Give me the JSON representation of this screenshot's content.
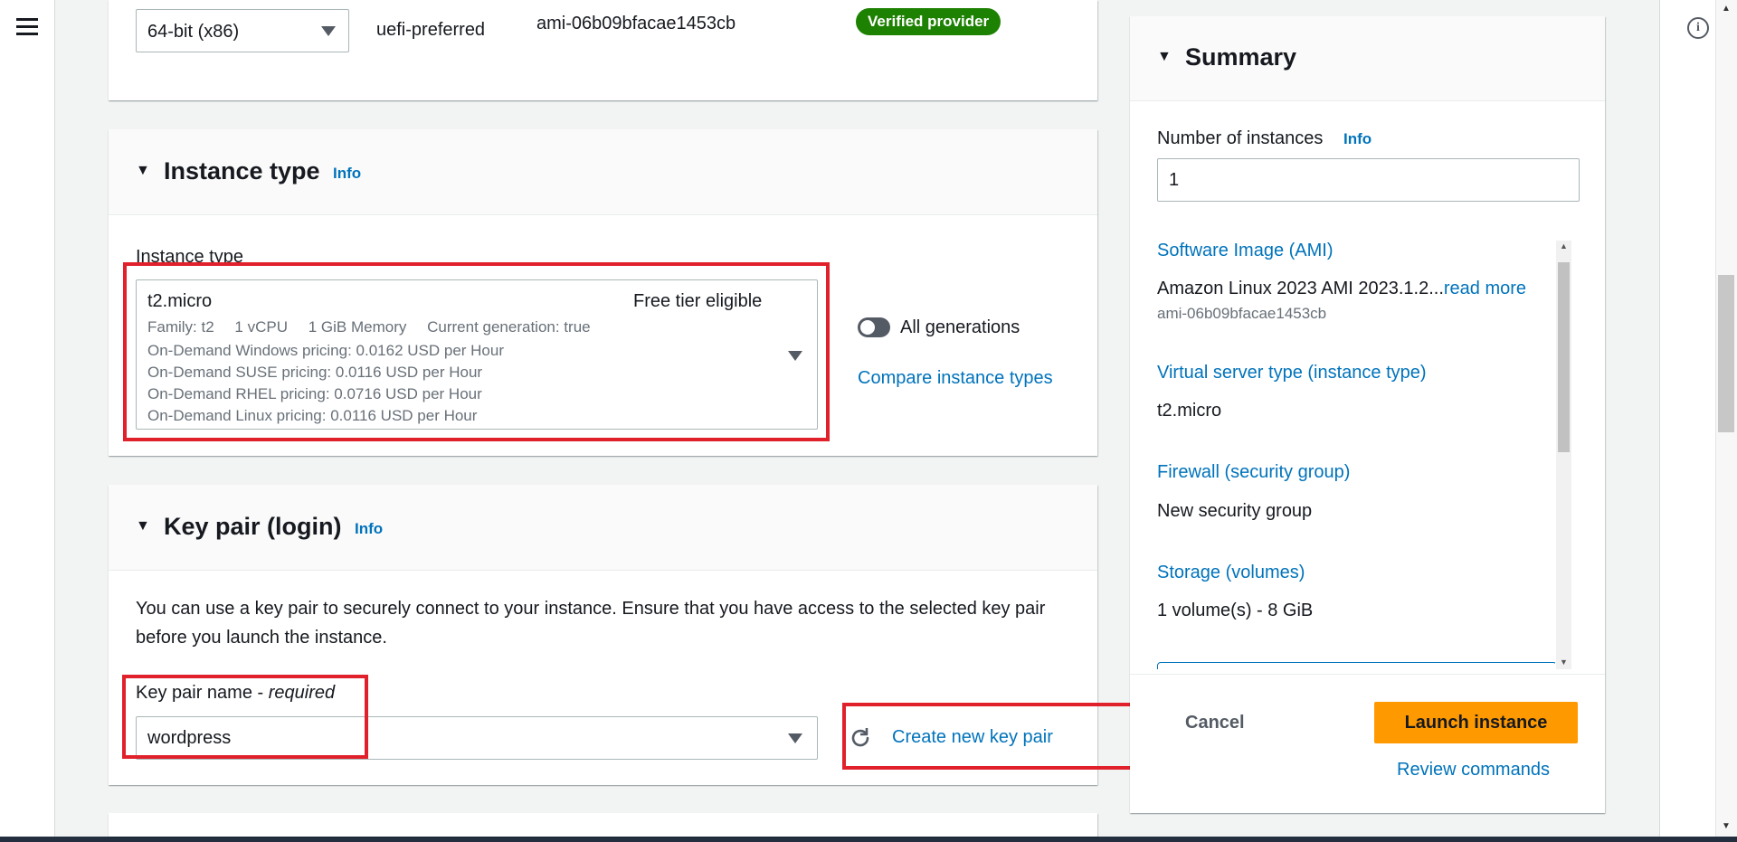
{
  "top_row": {
    "architecture_select": "64-bit (x86)",
    "boot_mode": "uefi-preferred",
    "ami_id": "ami-06b09bfacae1453cb",
    "badge": "Verified provider"
  },
  "instance_type_section": {
    "title": "Instance type",
    "info": "Info",
    "field_label": "Instance type",
    "selected_type": "t2.micro",
    "free_tier": "Free tier eligible",
    "details": [
      "Family: t2",
      "1 vCPU",
      "1 GiB Memory",
      "Current generation: true"
    ],
    "pricing": [
      "On-Demand Windows pricing: 0.0162 USD per Hour",
      "On-Demand SUSE pricing: 0.0116 USD per Hour",
      "On-Demand RHEL pricing: 0.0716 USD per Hour",
      "On-Demand Linux pricing: 0.0116 USD per Hour"
    ],
    "all_generations_label": "All generations",
    "all_generations_on": false,
    "compare_link": "Compare instance types"
  },
  "key_pair_section": {
    "title": "Key pair (login)",
    "info": "Info",
    "description": "You can use a key pair to securely connect to your instance. Ensure that you have access to the selected key pair before you launch the instance.",
    "field_label": "Key pair name - ",
    "field_label_req": "required",
    "selected": "wordpress",
    "create_link": "Create new key pair"
  },
  "summary": {
    "title": "Summary",
    "num_instances_label": "Number of instances",
    "info": "Info",
    "num_instances_value": "1",
    "ami_heading": "Software Image (AMI)",
    "ami_name": "Amazon Linux 2023 AMI 2023.1.2...",
    "read_more": "read more",
    "ami_id": "ami-06b09bfacae1453cb",
    "server_type_heading": "Virtual server type (instance type)",
    "server_type_value": "t2.micro",
    "firewall_heading": "Firewall (security group)",
    "firewall_value": "New security group",
    "storage_heading": "Storage (volumes)",
    "storage_value": "1 volume(s) - 8 GiB",
    "cancel": "Cancel",
    "launch": "Launch instance",
    "review": "Review commands"
  },
  "colors": {
    "accent_link": "#0073bb",
    "primary_button": "#ff9900",
    "badge_green": "#1d8102",
    "highlight_red": "#e0202a"
  }
}
